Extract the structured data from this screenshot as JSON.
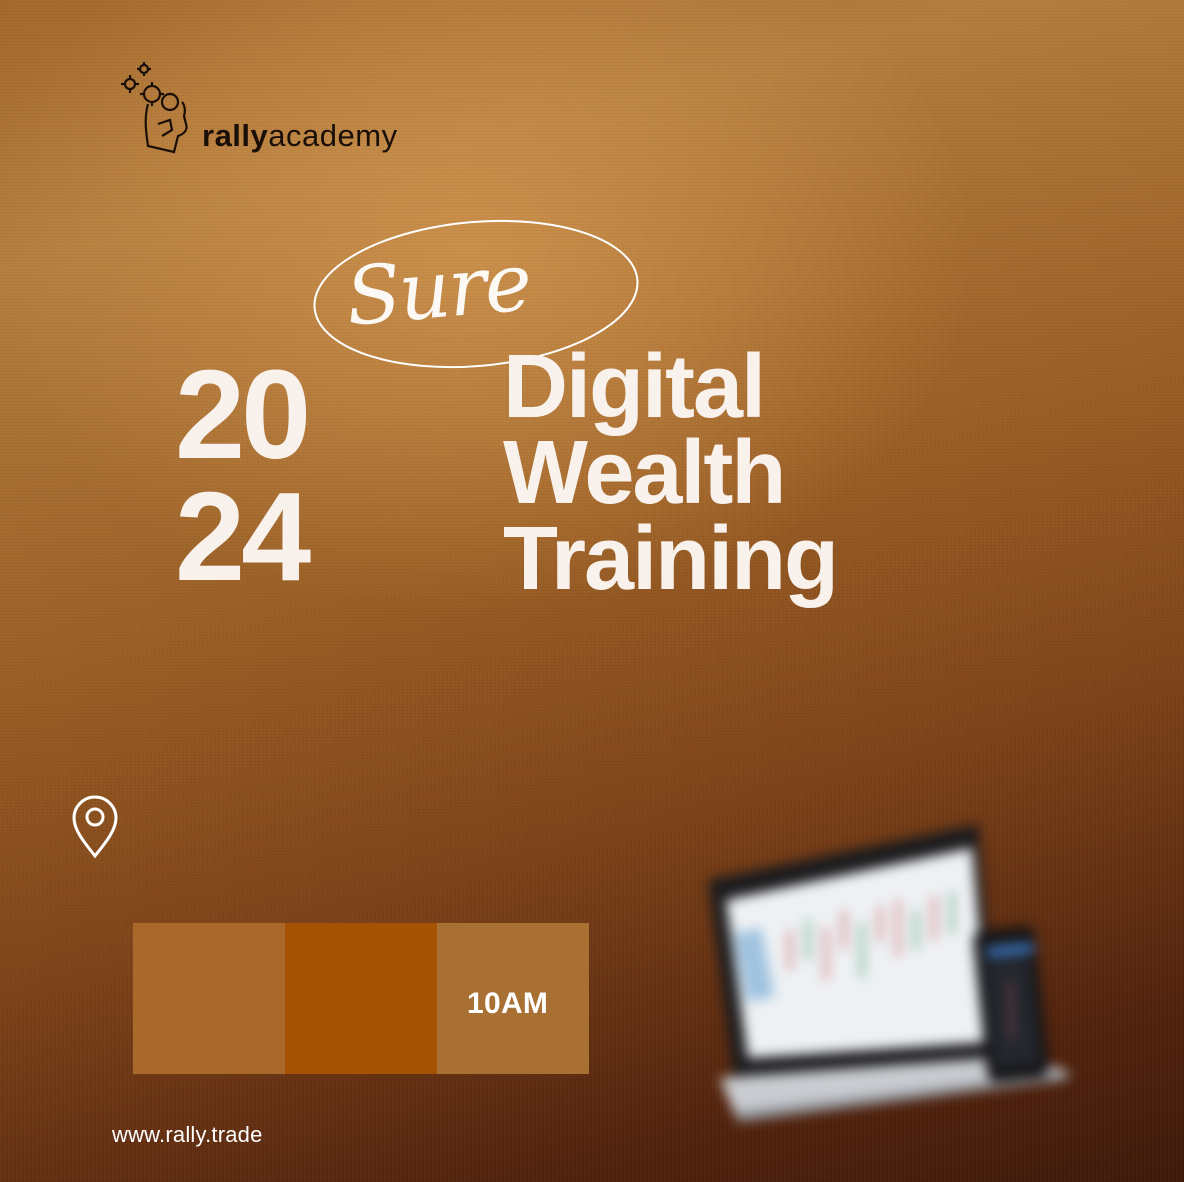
{
  "brand": {
    "name_bold": "rally",
    "name_regular": "academy"
  },
  "headline": {
    "script_word": "Sure",
    "year_top": "20",
    "year_bottom": "24",
    "title_lines": [
      "Digital",
      "Wealth",
      "Training"
    ]
  },
  "details": {
    "time": "10AM"
  },
  "footer": {
    "url": "www.rally.trade"
  },
  "colors": {
    "box_1": "#a8692a",
    "box_2": "#a55203",
    "box_3": "#a97034",
    "text_light": "#f8f1ec",
    "logo_dark": "#1a0f07"
  },
  "icons": [
    "gears-head-logo-icon",
    "location-pin-icon",
    "laptop-trading-chart-image",
    "phone-image"
  ]
}
